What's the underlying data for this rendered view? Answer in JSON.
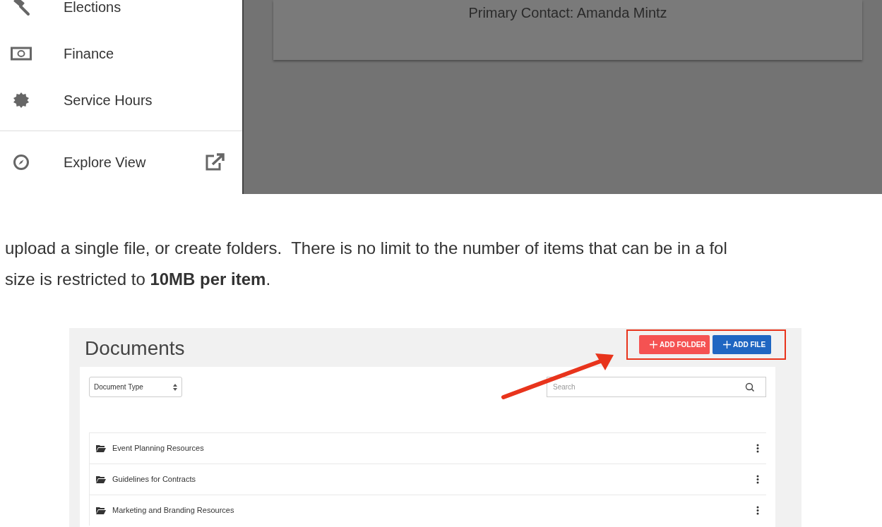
{
  "sidebar": {
    "items": [
      {
        "label": "Elections"
      },
      {
        "label": "Finance"
      },
      {
        "label": "Service Hours"
      }
    ],
    "explore": {
      "label": "Explore View",
      "external": true
    }
  },
  "profile_card": {
    "primary_contact": "Primary Contact: Amanda Mintz"
  },
  "paragraph": [
    "upload a single file, or create folders.  There is no limit to the number of items that can be in a fol",
    "size is restricted to **10MB per item**."
  ],
  "documents": {
    "title": "Documents",
    "buttons": [
      {
        "label": "ADD FOLDER",
        "kind": "folder"
      },
      {
        "label": "ADD FILE",
        "kind": "file"
      }
    ],
    "filter": {
      "value": "Document Type"
    },
    "search": {
      "placeholder": "Search"
    },
    "folders": [
      {
        "name": "Event Planning Resources"
      },
      {
        "name": "Guidelines for Contracts"
      },
      {
        "name": "Marketing and Branding Resources"
      }
    ]
  }
}
